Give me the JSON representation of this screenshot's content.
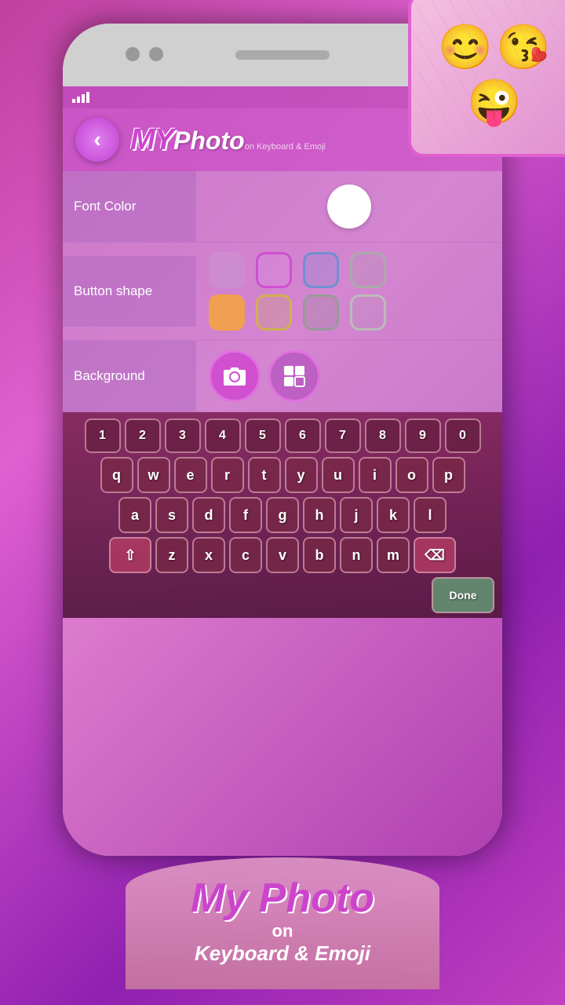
{
  "app": {
    "title_my": "MY",
    "title_photo": "Photo",
    "title_sub_line1": "on",
    "title_sub_line2": "Keyboard & Emoji"
  },
  "header": {
    "back_label": "‹"
  },
  "settings": {
    "font_color_label": "Font Color",
    "button_shape_label": "Button shape",
    "background_label": "Background"
  },
  "keyboard": {
    "number_row": [
      "1",
      "2",
      "3",
      "4",
      "5",
      "6",
      "7",
      "8",
      "9",
      "0"
    ],
    "row1": [
      "q",
      "w",
      "e",
      "r",
      "t",
      "y",
      "u",
      "i",
      "o",
      "p"
    ],
    "row2": [
      "a",
      "s",
      "d",
      "f",
      "g",
      "h",
      "j",
      "k",
      "l"
    ],
    "row3_left": "⇧",
    "row3": [
      "z",
      "x",
      "c",
      "v",
      "b",
      "n",
      "m"
    ],
    "row3_right": "⌫",
    "done_label": "Done"
  },
  "bottom_brand": {
    "line1": "My Photo",
    "line2": "on",
    "line3": "Keyboard & Emoji"
  },
  "emojis": [
    "😊",
    "😘",
    "😜"
  ]
}
